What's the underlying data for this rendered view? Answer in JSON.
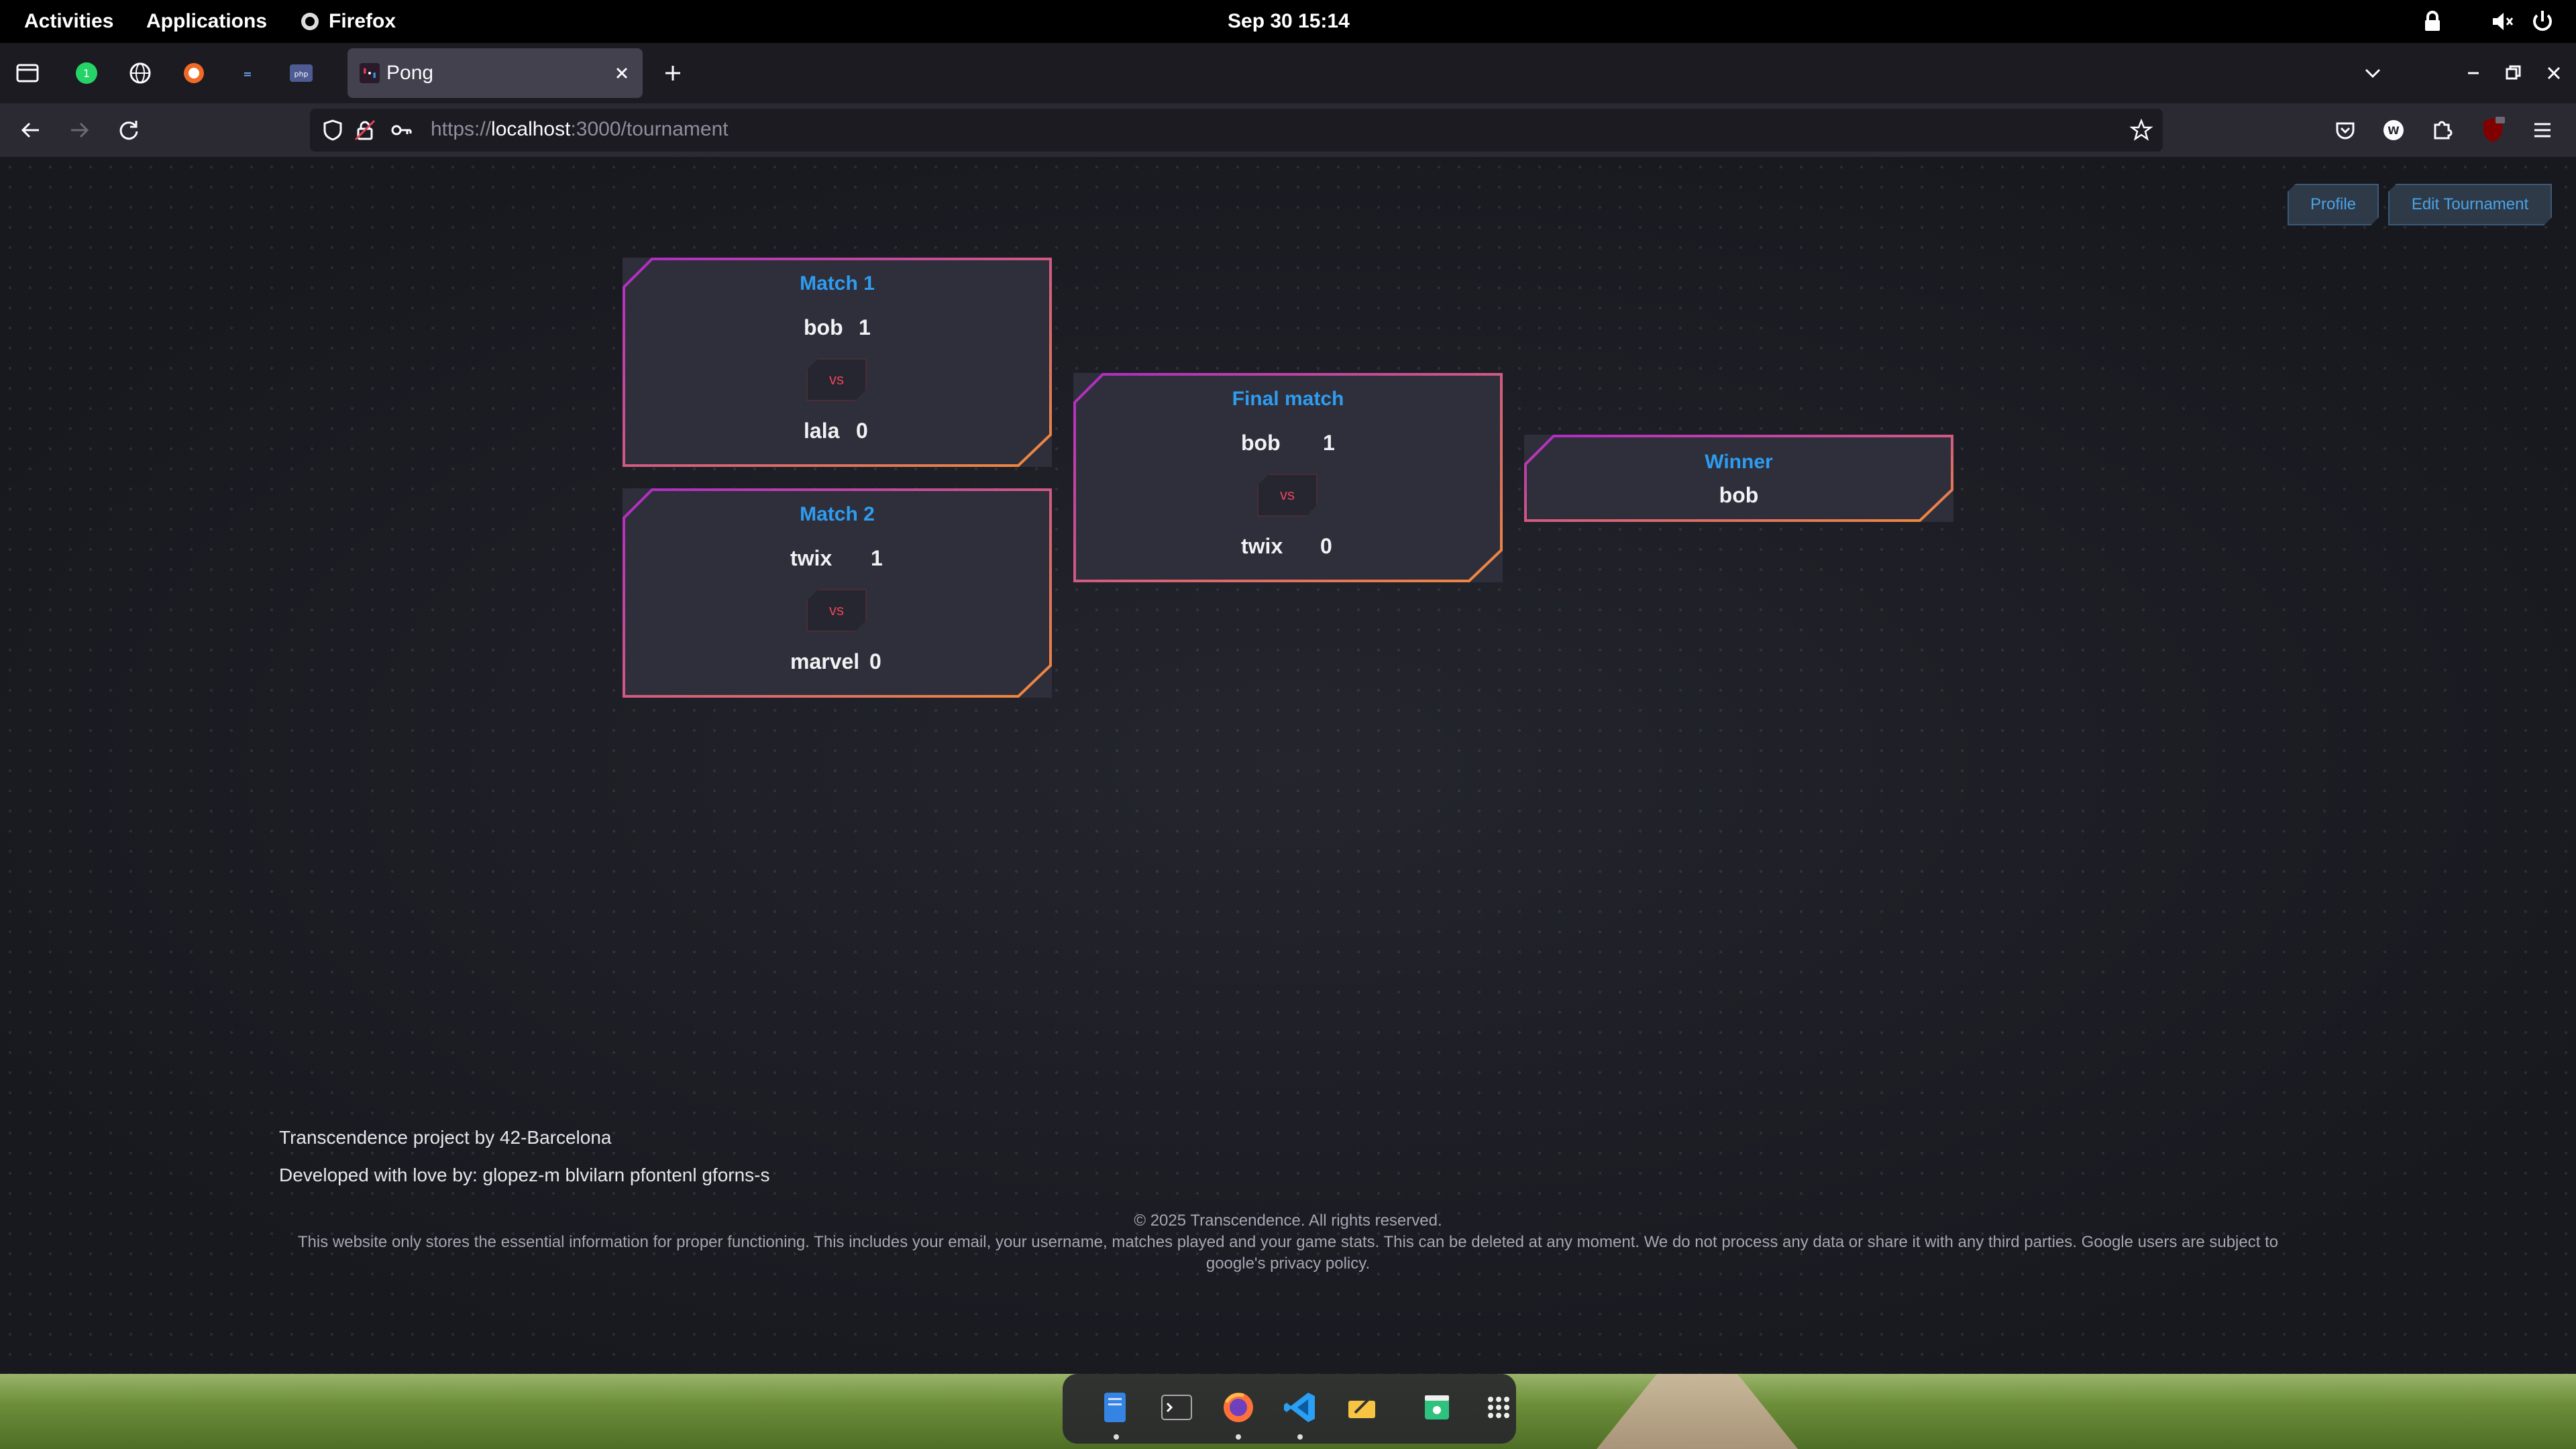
{
  "topbar": {
    "activities": "Activities",
    "applications": "Applications",
    "app_name": "Firefox",
    "datetime": "Sep 30  15:14"
  },
  "tabs": {
    "active_title": "Pong"
  },
  "navbar": {
    "url_prefix": "https://",
    "url_host": "localhost",
    "url_rest": ":3000/tournament"
  },
  "header_buttons": {
    "profile": "Profile",
    "edit_tournament": "Edit Tournament"
  },
  "bracket": {
    "match1": {
      "title": "Match 1",
      "p1": "bob",
      "s1": "1",
      "vs": "vs",
      "p2": "lala",
      "s2": "0"
    },
    "match2": {
      "title": "Match 2",
      "p1": "twix",
      "s1": "1",
      "vs": "vs",
      "p2": "marvel",
      "s2": "0"
    },
    "final": {
      "title": "Final match",
      "p1": "bob",
      "s1": "1",
      "vs": "vs",
      "p2": "twix",
      "s2": "0"
    },
    "winner": {
      "title": "Winner",
      "name": "bob"
    }
  },
  "footer": {
    "project": "Transcendence project by 42-Barcelona",
    "developers": "Developed with love by: glopez-m blvilarn pfontenl gforns-s",
    "copyright": "© 2025 Transcendence. All rights reserved.",
    "privacy_line1": "This website only stores the essential information for proper functioning. This includes your email, your username, matches played and your game stats. This can be deleted at any moment. We do not process any data or share it with any third parties. Google users are subject to",
    "privacy_line2": "google's privacy policy."
  },
  "colors": {
    "accent_blue": "#2e9cf0",
    "vs_red": "#e8445a",
    "border_purple": "#b02ac8",
    "border_orange": "#f08a3c"
  }
}
